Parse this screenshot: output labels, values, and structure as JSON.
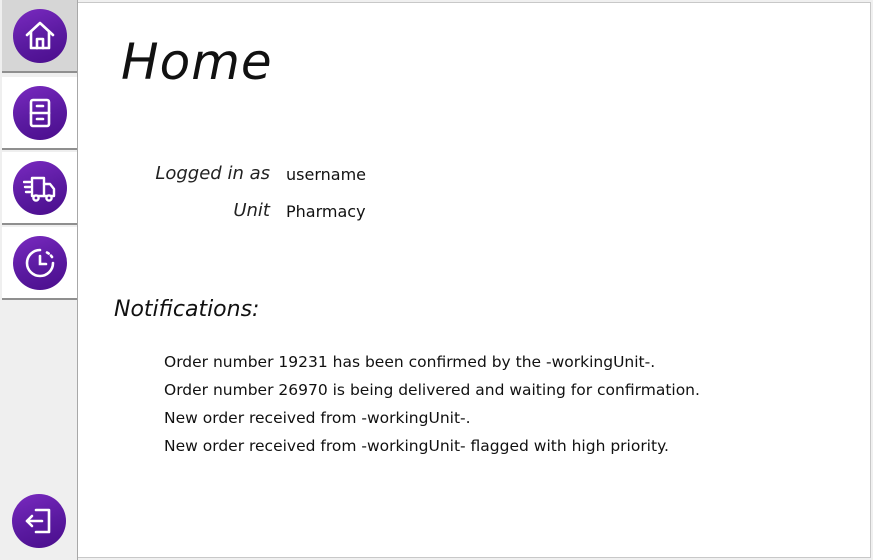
{
  "sidebar": {
    "items": [
      {
        "icon": "home-icon",
        "active": true
      },
      {
        "icon": "cabinet-icon",
        "active": false
      },
      {
        "icon": "delivery-truck-icon",
        "active": false
      },
      {
        "icon": "history-clock-icon",
        "active": false
      }
    ],
    "logout_icon": "logout-icon",
    "accent_color": "#5a1aa0"
  },
  "page": {
    "title": "Home"
  },
  "user_info": {
    "logged_in_label": "Logged in as",
    "logged_in_value": "username",
    "unit_label": "Unit",
    "unit_value": "Pharmacy"
  },
  "notifications": {
    "heading": "Notifications:",
    "items": [
      "Order number 19231 has been confirmed by the -workingUnit-.",
      "Order number 26970 is being delivered and waiting for confirmation.",
      "New order received from -workingUnit-.",
      "New order received from -workingUnit- flagged with high priority."
    ]
  }
}
